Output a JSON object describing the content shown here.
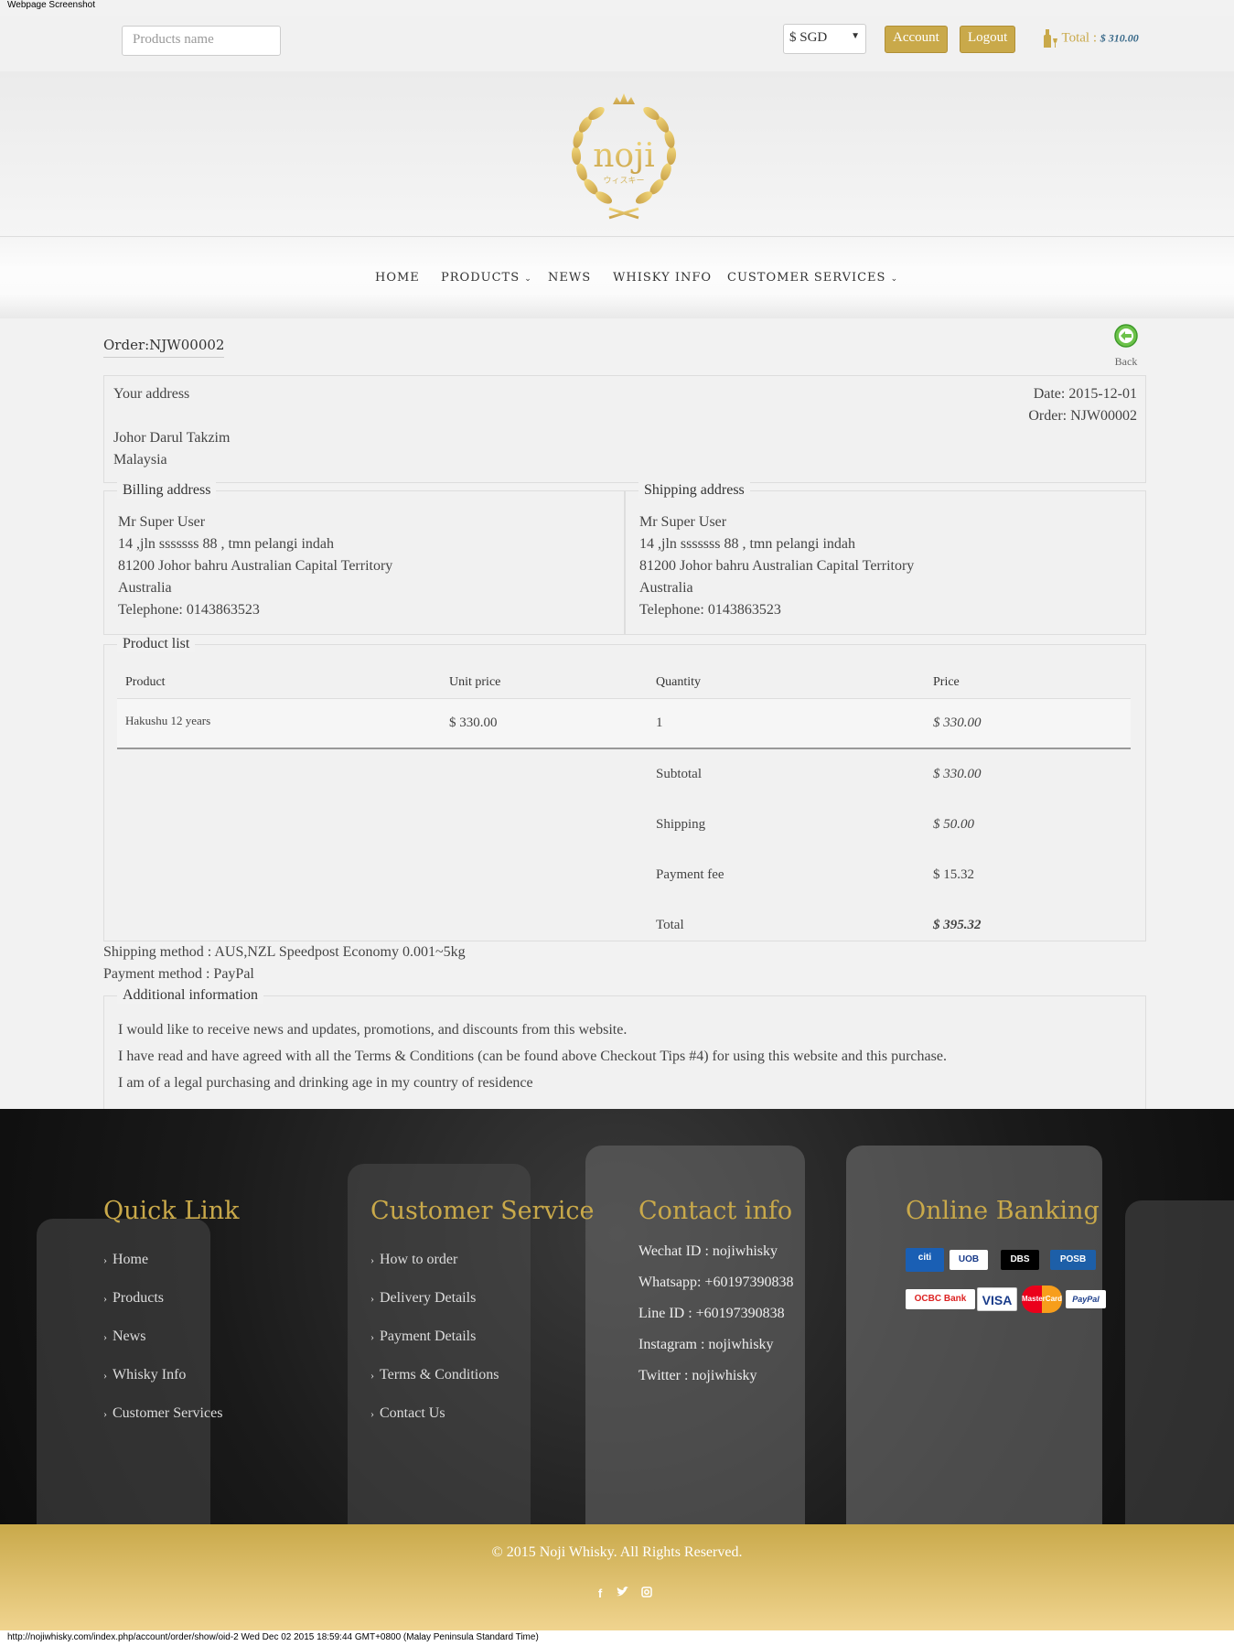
{
  "screenshot_label": "Webpage Screenshot",
  "topbar": {
    "search_placeholder": "Products name",
    "currency": "$ SGD",
    "account_label": "Account",
    "logout_label": "Logout",
    "cart_label": "Total : ",
    "cart_amount": "$ 310.00"
  },
  "logo": {
    "text": "noji",
    "subtext": "ウィスキー"
  },
  "nav": {
    "home": "HOME",
    "products": "PRODUCTS",
    "news": "NEWS",
    "whisky_info": "WHISKY INFO",
    "customer_services": "CUSTOMER SERVICES"
  },
  "order": {
    "title": "Order:NJW00002",
    "back_label": "Back",
    "your_address_label": "Your address",
    "your_address_line1": "Johor Darul Takzim",
    "your_address_line2": "Malaysia",
    "date": "Date: 2015-12-01",
    "order_no": "Order: NJW00002"
  },
  "billing": {
    "legend": "Billing address",
    "name": "Mr Super User",
    "street": "14 ,jln sssssss 88 , tmn pelangi indah",
    "city": "81200 Johor bahru Australian Capital Territory",
    "country": "Australia",
    "phone": "Telephone: 0143863523"
  },
  "shipping": {
    "legend": "Shipping address",
    "name": "Mr Super User",
    "street": "14 ,jln sssssss 88 , tmn pelangi indah",
    "city": "81200 Johor bahru Australian Capital Territory",
    "country": "Australia",
    "phone": "Telephone: 0143863523"
  },
  "products": {
    "legend": "Product list",
    "headers": {
      "product": "Product",
      "unit_price": "Unit price",
      "quantity": "Quantity",
      "price": "Price"
    },
    "items": [
      {
        "name": "Hakushu 12 years",
        "unit_price": "$ 330.00",
        "quantity": "1",
        "price": "$ 330.00"
      }
    ],
    "subtotal_label": "Subtotal",
    "subtotal": "$ 330.00",
    "shipping_label": "Shipping",
    "shipping": "$ 50.00",
    "fee_label": "Payment fee",
    "fee": "$ 15.32",
    "total_label": "Total",
    "total": "$ 395.32"
  },
  "methods": {
    "shipping": "Shipping method : AUS,NZL Speedpost Economy 0.001~5kg",
    "payment": "Payment method : PayPal"
  },
  "additional": {
    "legend": "Additional information",
    "lines": [
      "I would like to receive news and updates, promotions, and discounts from this website.",
      "I have read and have agreed with all the Terms & Conditions (can be found above Checkout Tips #4) for using this website and this purchase.",
      "I am of a legal purchasing and drinking age in my country of residence"
    ]
  },
  "footer": {
    "quick_link_title": "Quick Link",
    "quick_links": [
      "Home",
      "Products",
      "News",
      "Whisky Info",
      "Customer Services"
    ],
    "customer_service_title": "Customer Service",
    "customer_service_links": [
      "How to order",
      "Delivery Details",
      "Payment Details",
      "Terms & Conditions",
      "Contact Us"
    ],
    "contact_title": "Contact info",
    "contact_lines": [
      "Wechat ID : nojiwhisky",
      "Whatsapp: +60197390838",
      "Line ID : +60197390838",
      "Instagram : nojiwhisky",
      "Twitter : nojiwhisky"
    ],
    "banking_title": "Online Banking",
    "banks": [
      "citi",
      "UOB",
      "DBS",
      "POSB",
      "OCBC Bank",
      "VISA",
      "MasterCard",
      "PayPal"
    ],
    "copyright": "© 2015 Noji Whisky. All Rights Reserved.",
    "social_icons": [
      "facebook-icon",
      "twitter-icon",
      "instagram-icon"
    ]
  },
  "status_bar": "http://nojiwhisky.com/index.php/account/order/show/oid-2 Wed Dec 02 2015 18:59:44 GMT+0800 (Malay Peninsula Standard Time)",
  "colors": {
    "gold": "#c9a94a",
    "price_blue": "#3a6a8a",
    "footer_dark": "#1a1a1a"
  }
}
